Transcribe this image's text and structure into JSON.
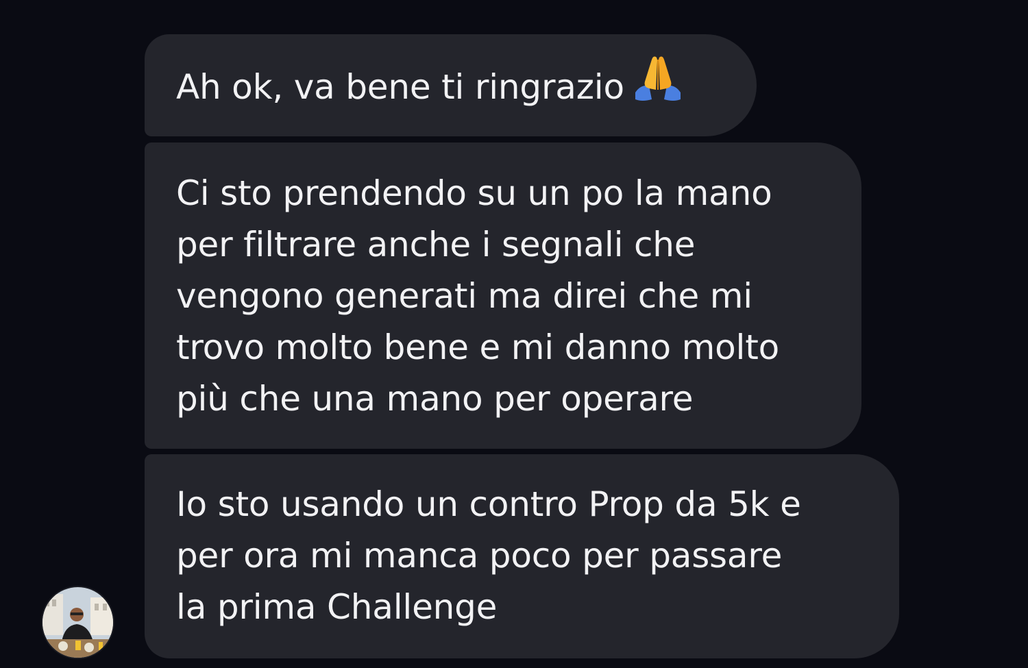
{
  "messages": [
    {
      "text": "Ah ok, va bene ti ringrazio",
      "emoji": "folded-hands"
    },
    {
      "text": "Ci sto prendendo su un po la mano\nper filtrare anche i segnali che\nvengono generati ma direi che mi\ntrovo molto bene e mi danno molto\npiù che una mano per operare"
    },
    {
      "text": "Io sto usando un contro Prop da 5k e\nper ora mi manca poco per passare\nla prima Challenge"
    }
  ],
  "colors": {
    "background": "#0a0b13",
    "bubble": "#24252c",
    "text": "#f2f2f4"
  }
}
